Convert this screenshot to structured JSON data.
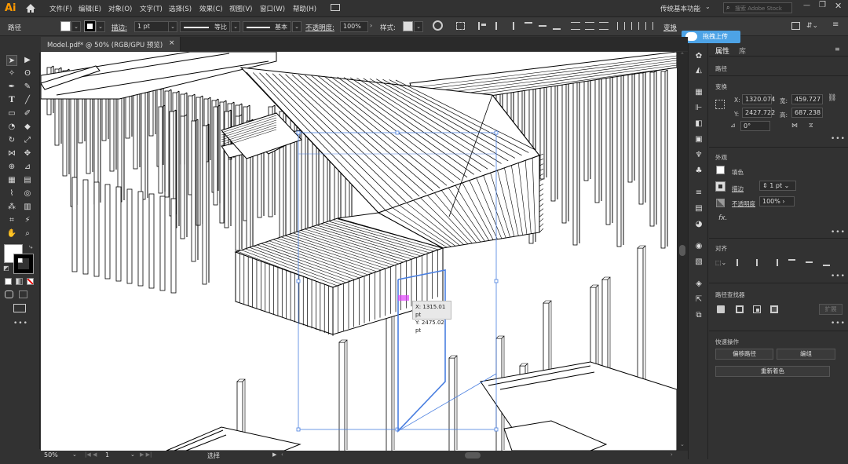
{
  "app": {
    "logo": "Ai"
  },
  "menu": [
    "文件(F)",
    "编辑(E)",
    "对象(O)",
    "文字(T)",
    "选择(S)",
    "效果(C)",
    "视图(V)",
    "窗口(W)",
    "帮助(H)"
  ],
  "workspace": "传统基本功能",
  "search": {
    "placeholder": "搜索 Adobe Stock"
  },
  "control": {
    "path_label": "路径",
    "stroke_label": "描边:",
    "stroke_value": "1 pt",
    "profile1": "等比",
    "profile2": "基本",
    "opacity_label": "不透明度:",
    "opacity_value": "100%",
    "style_label": "样式:",
    "transform_label": "变换"
  },
  "upload_button": "拖拽上传",
  "document_tab": {
    "title": "Model.pdf* @ 50% (RGB/GPU 预览)",
    "close": "×"
  },
  "tooltip": {
    "x": "X: 1315.01 pt",
    "y": "Y: 2475.02 pt"
  },
  "status": {
    "zoom": "50%",
    "page": "1",
    "mode": "选择"
  },
  "properties": {
    "tab_props": "属性",
    "tab_lib": "库",
    "object_type": "路径",
    "transform_title": "变换",
    "x_label": "X:",
    "x_value": "1320.074",
    "y_label": "Y:",
    "y_value": "2427.722",
    "w_label": "宽:",
    "w_value": "459.727",
    "h_label": "高:",
    "h_value": "687.238",
    "angle_value": "0°",
    "appearance_title": "外观",
    "fill_label": "填色",
    "stroke_label": "描边",
    "stroke_value": "1 pt",
    "opacity_label": "不透明度",
    "opacity_value": "100%",
    "fx": "fx.",
    "align_title": "对齐",
    "pathfinder_title": "路径查找器",
    "expand": "扩展",
    "quick_title": "快速操作",
    "offset_path": "偏移路径",
    "group": "编组",
    "recolor": "重新着色"
  },
  "colors": {
    "selection": "#4a7fe0",
    "accent": "#4da3e6",
    "bg": "#323232"
  }
}
